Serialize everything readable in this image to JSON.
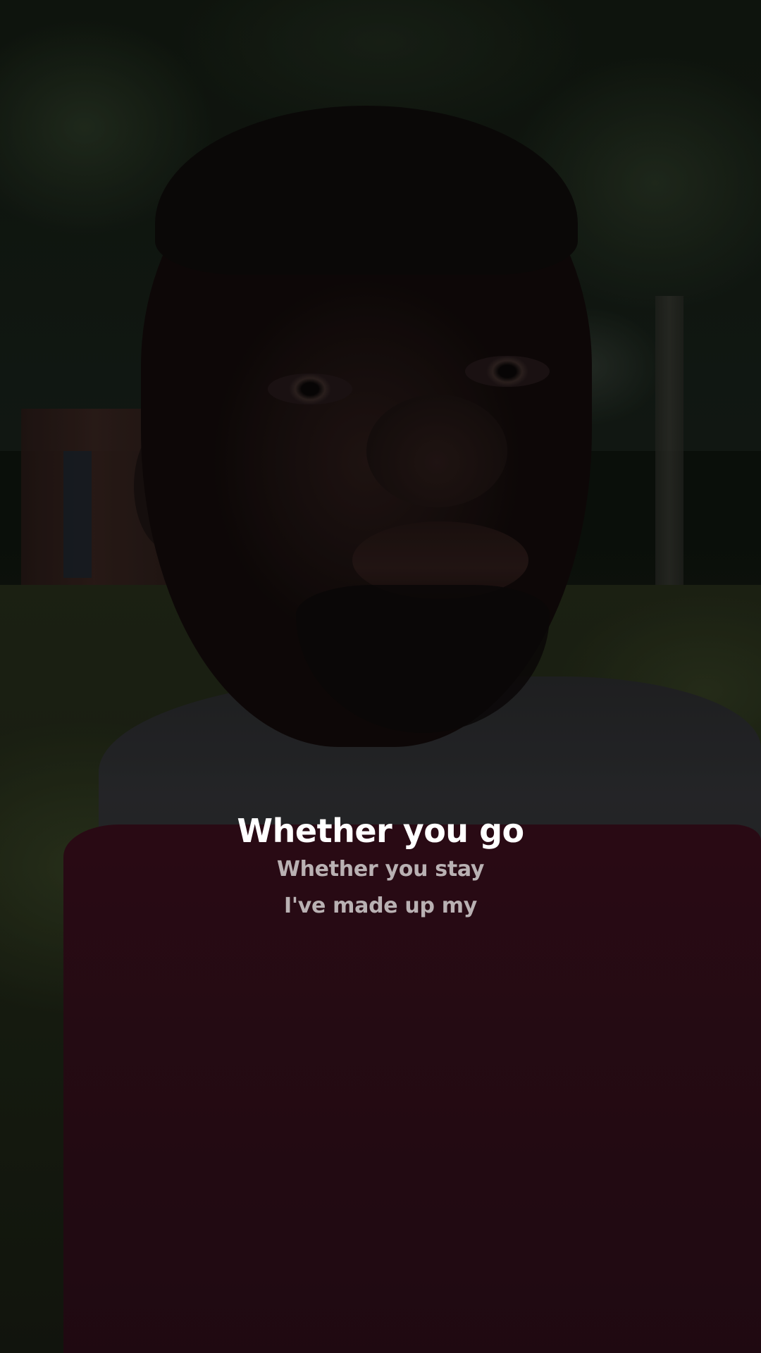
{
  "video": {
    "background_icon": "video-frame"
  },
  "lyrics": {
    "current_line": "Whether you go",
    "upcoming_lines": [
      "Whether you stay",
      "I've made up my"
    ],
    "current_color": "#ffffff",
    "upcoming_color": "#b9b1b3"
  }
}
